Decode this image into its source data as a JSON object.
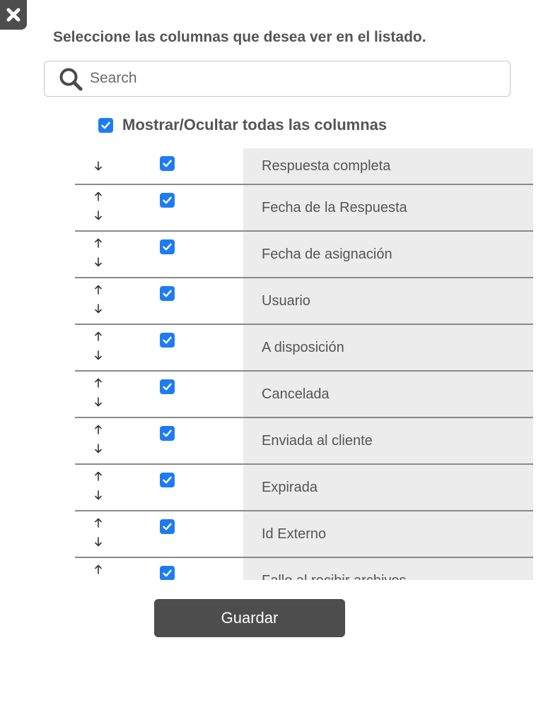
{
  "dialog": {
    "title": "Seleccione las columnas que desea ver en el listado.",
    "close_icon": "close-icon"
  },
  "search": {
    "placeholder": "Search",
    "value": "",
    "icon": "search-icon"
  },
  "toggle_all": {
    "label": "Mostrar/Ocultar todas las columnas",
    "checked": true
  },
  "columns": [
    {
      "label": "Respuesta completa",
      "checked": true,
      "can_move_up": false,
      "can_move_down": true
    },
    {
      "label": "Fecha de la Respuesta",
      "checked": true,
      "can_move_up": true,
      "can_move_down": true
    },
    {
      "label": "Fecha de asignación",
      "checked": true,
      "can_move_up": true,
      "can_move_down": true
    },
    {
      "label": "Usuario",
      "checked": true,
      "can_move_up": true,
      "can_move_down": true
    },
    {
      "label": "A disposición",
      "checked": true,
      "can_move_up": true,
      "can_move_down": true
    },
    {
      "label": "Cancelada",
      "checked": true,
      "can_move_up": true,
      "can_move_down": true
    },
    {
      "label": "Enviada al cliente",
      "checked": true,
      "can_move_up": true,
      "can_move_down": true
    },
    {
      "label": "Expirada",
      "checked": true,
      "can_move_up": true,
      "can_move_down": true
    },
    {
      "label": "Id Externo",
      "checked": true,
      "can_move_up": true,
      "can_move_down": true
    },
    {
      "label": "Fallo al recibir archivos",
      "checked": true,
      "can_move_up": true,
      "can_move_down": true
    }
  ],
  "save_button": {
    "label": "Guardar"
  },
  "colors": {
    "checkbox": "#1e7cf2",
    "button_bg": "#4d4d4d",
    "row_label_bg": "#ececec",
    "text": "#555555"
  }
}
